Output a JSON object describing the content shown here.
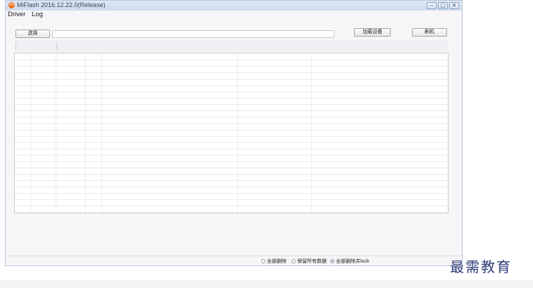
{
  "window": {
    "title": "MiFlash 2016.12.22.0(Release)",
    "controls": {
      "minimize": "–",
      "maximize": "▢",
      "close": "✕"
    }
  },
  "menu": [
    "Driver",
    "Log"
  ],
  "toolbar": {
    "select_label": "选择",
    "load_devices_label": "加载设备",
    "flash_label": "刷机",
    "path_value": ""
  },
  "table": {
    "headers": [
      "",
      ""
    ]
  },
  "flash_options": {
    "selected_index": 2,
    "options": [
      "全部删除",
      "保留所有数据",
      "全部删除并lock"
    ]
  },
  "watermark": "最需教育",
  "icons": {
    "app": "miflash-logo-icon"
  },
  "colors": {
    "accent": "#2a66b8",
    "logo": "#f26c1f"
  }
}
